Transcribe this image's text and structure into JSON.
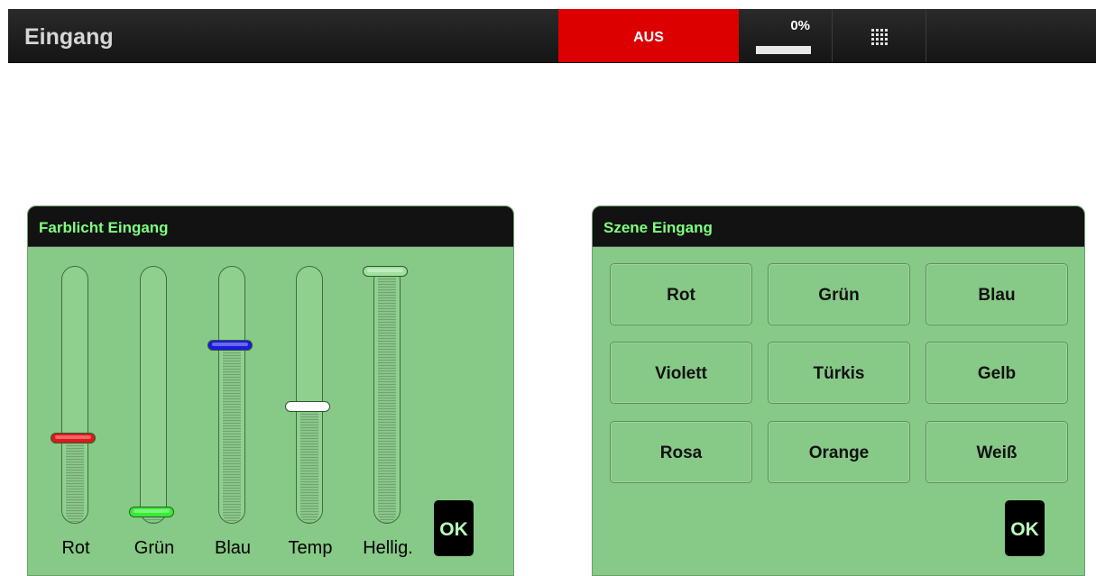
{
  "header": {
    "title": "Eingang",
    "power_label": "AUS",
    "power_color": "#dd0000",
    "dim_value": "0%",
    "dim_level_percent": 0,
    "grid_icon": "grid-icon"
  },
  "color_panel": {
    "title": "Farblicht Eingang",
    "sliders": [
      {
        "label": "Rot",
        "knob_color": "#e01818",
        "level_percent": 32
      },
      {
        "label": "Grün",
        "knob_color": "#33ee33",
        "level_percent": 2
      },
      {
        "label": "Blau",
        "knob_color": "#1a1ae0",
        "level_percent": 70
      },
      {
        "label": "Temp",
        "knob_color": "#ffffff",
        "level_percent": 45
      },
      {
        "label": "Hellig.",
        "knob_color": "#9ee09e",
        "level_percent": 100
      }
    ],
    "ok_label": "OK"
  },
  "scene_panel": {
    "title": "Szene Eingang",
    "scenes": [
      "Rot",
      "Grün",
      "Blau",
      "Violett",
      "Türkis",
      "Gelb",
      "Rosa",
      "Orange",
      "Weiß"
    ],
    "ok_label": "OK"
  }
}
